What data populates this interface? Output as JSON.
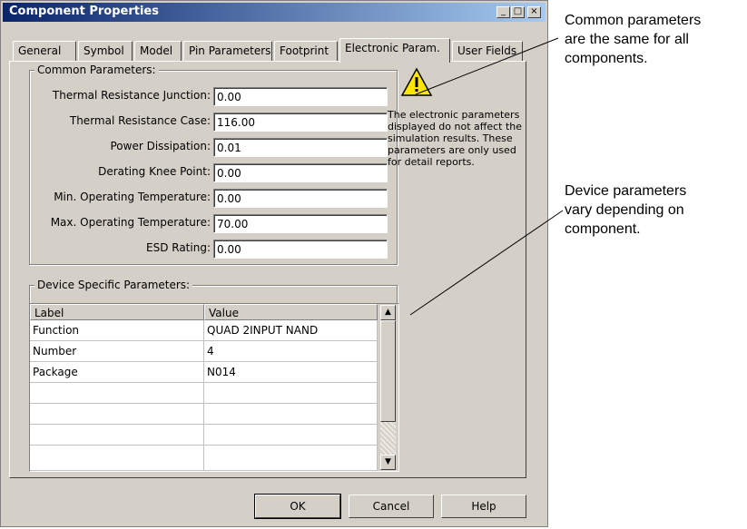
{
  "window": {
    "title": "Component Properties",
    "minimize": "_",
    "maximize": "□",
    "close": "×"
  },
  "tabs": [
    {
      "label": "General"
    },
    {
      "label": "Symbol"
    },
    {
      "label": "Model"
    },
    {
      "label": "Pin Parameters"
    },
    {
      "label": "Footprint"
    },
    {
      "label": "Electronic Param."
    },
    {
      "label": "User Fields"
    }
  ],
  "active_tab": "Electronic Param.",
  "common": {
    "group_label": "Common Parameters:",
    "params": [
      {
        "label": "Thermal Resistance Junction:",
        "value": "0.00"
      },
      {
        "label": "Thermal Resistance Case:",
        "value": "116.00"
      },
      {
        "label": "Power Dissipation:",
        "value": "0.01"
      },
      {
        "label": "Derating Knee Point:",
        "value": "0.00"
      },
      {
        "label": "Min. Operating Temperature:",
        "value": "0.00"
      },
      {
        "label": "Max. Operating Temperature:",
        "value": "70.00"
      },
      {
        "label": "ESD Rating:",
        "value": "0.00"
      }
    ]
  },
  "warning": {
    "text": "The electronic parameters displayed do not affect the simulation results. These parameters are only used for detail reports."
  },
  "device": {
    "group_label": "Device Specific Parameters:",
    "columns": [
      "Label",
      "Value"
    ],
    "rows": [
      [
        "Function",
        "QUAD 2INPUT NAND"
      ],
      [
        "Number",
        "4"
      ],
      [
        "Package",
        "N014"
      ]
    ]
  },
  "buttons": {
    "ok": "OK",
    "cancel": "Cancel",
    "help": "Help"
  },
  "callouts": {
    "common": [
      "Common parameters",
      "are the same for all",
      "components."
    ],
    "device": [
      "Device parameters",
      "vary depending on",
      "component."
    ]
  }
}
